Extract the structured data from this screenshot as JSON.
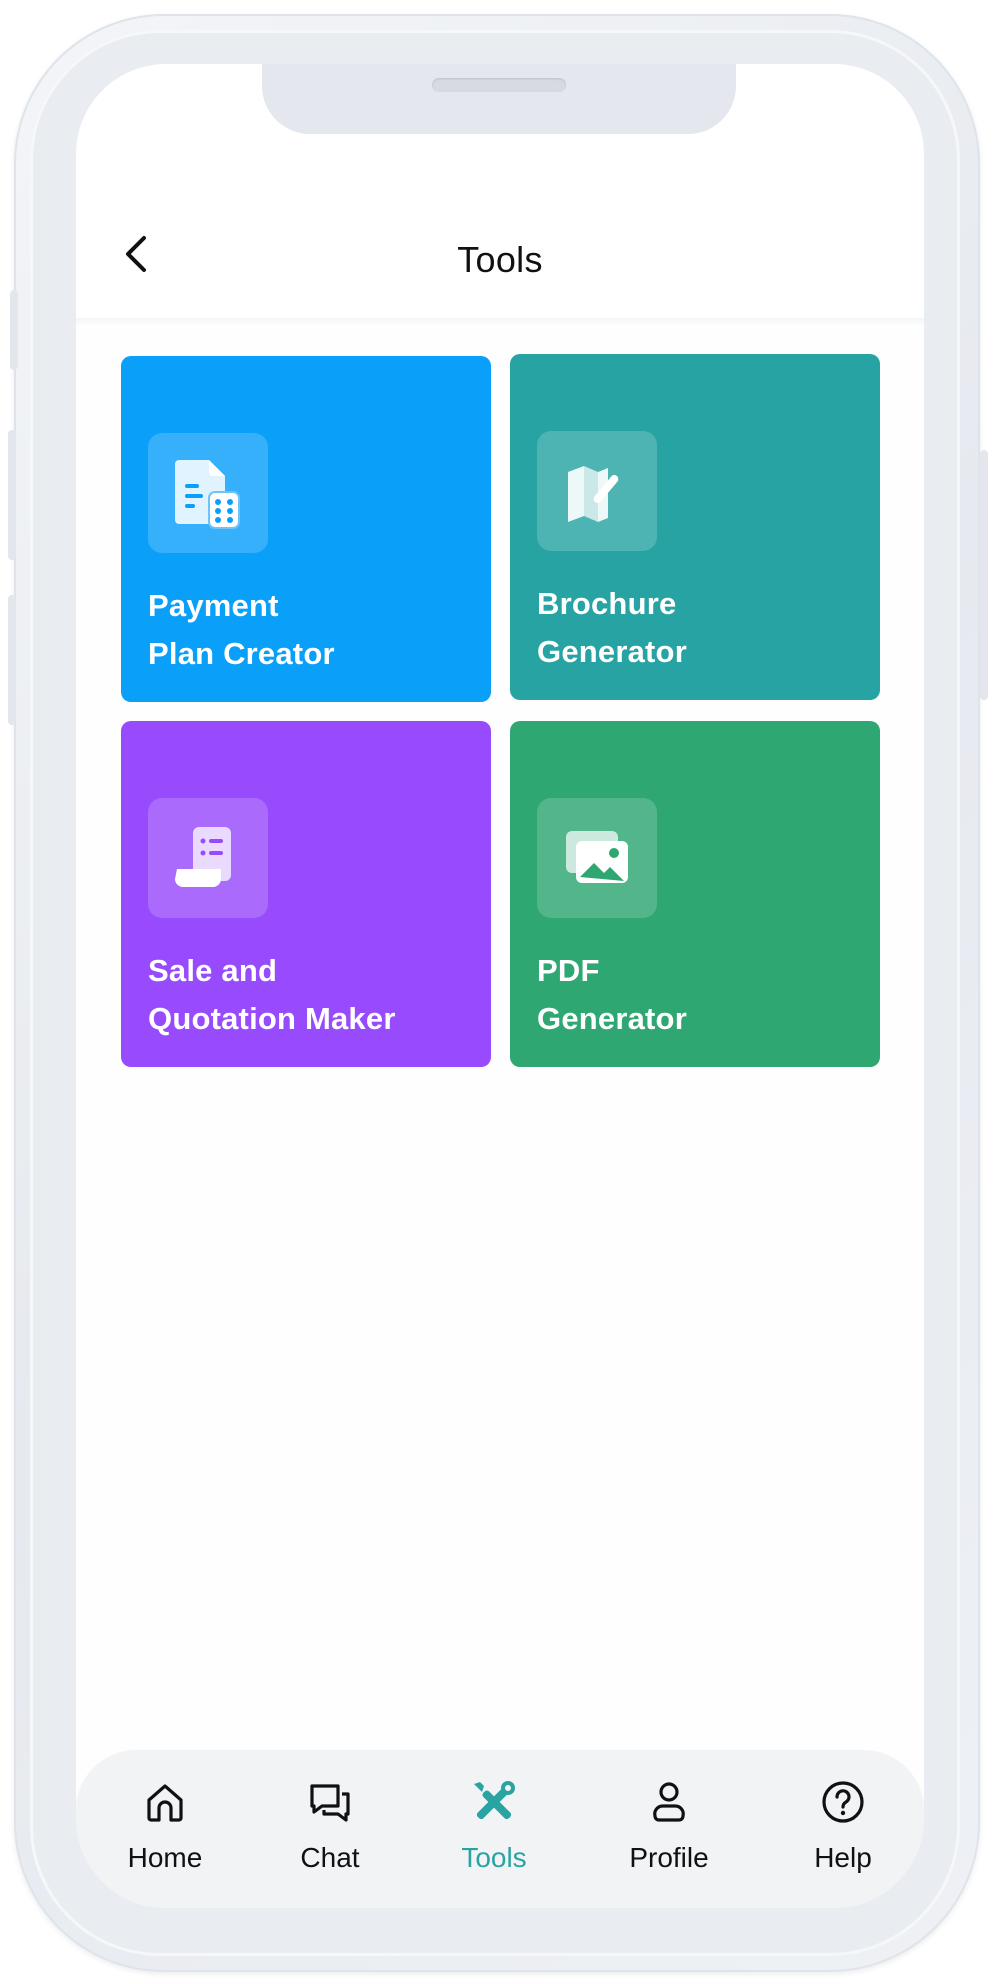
{
  "header": {
    "title": "Tools",
    "back_icon": "chevron-left-icon"
  },
  "tiles": [
    {
      "line1": "Payment",
      "line2": "Plan Creator",
      "icon": "document-calculator-icon",
      "color": "#0a9ff9"
    },
    {
      "line1": "Brochure",
      "line2": "Generator",
      "icon": "brochure-pen-icon",
      "color": "#27a3a3"
    },
    {
      "line1": "Sale and",
      "line2": "Quotation Maker",
      "icon": "receipt-list-icon",
      "color": "#984bfd"
    },
    {
      "line1": "PDF",
      "line2": "Generator",
      "icon": "image-gallery-icon",
      "color": "#2ea772"
    }
  ],
  "nav": {
    "items": [
      {
        "label": "Home",
        "icon": "home-icon",
        "active": false
      },
      {
        "label": "Chat",
        "icon": "chat-bubbles-icon",
        "active": false
      },
      {
        "label": "Tools",
        "icon": "tools-icon",
        "active": true
      },
      {
        "label": "Profile",
        "icon": "user-icon",
        "active": false
      },
      {
        "label": "Help",
        "icon": "help-circle-icon",
        "active": false
      }
    ],
    "active_color": "#2aa3a3"
  }
}
